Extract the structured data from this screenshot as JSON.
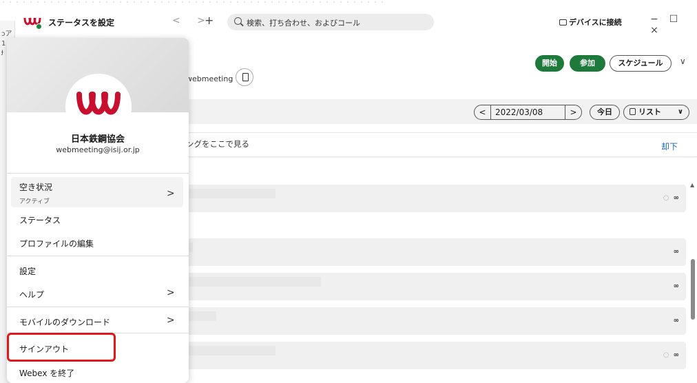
{
  "titlebar": {
    "title": "ステータスを設定",
    "nav_arrows": "< >",
    "add": "+",
    "search_placeholder": "検索、打ち合わせ、およびコール",
    "device_connect": "デバイスに接続",
    "win_min": "−",
    "win_max": "☐",
    "win_close": "×"
  },
  "header": {
    "meeting_id_suffix": "webmeeting",
    "start": "開始",
    "join": "参加",
    "schedule": "スケジュール",
    "chevron": "∨"
  },
  "datebar": {
    "prev": "<",
    "date": "2022/03/08",
    "next": ">",
    "today": "今日",
    "view": "リスト",
    "view_chevron": "∨"
  },
  "notice": {
    "text": "ングをここで見る",
    "dismiss": "却下"
  },
  "meeting_rows": [
    {
      "icons": "◌ ᴡ",
      "has_sync": true
    },
    {
      "icons": "ᴡ",
      "has_sync": false
    },
    {
      "icons": "ᴡ",
      "has_sync": false
    },
    {
      "icons": "ᴡ",
      "has_sync": false
    },
    {
      "icons": "◌ ᴡ",
      "has_sync": true
    }
  ],
  "row_icons": {
    "sync": "◌",
    "webex": "∞"
  },
  "profile": {
    "name": "日本鉄鋼協会",
    "email": "webmeeting@isij.or.jp"
  },
  "menu": {
    "availability": "空き状況",
    "availability_sub": "アクティブ",
    "chevron": ">",
    "status": "ステータス",
    "edit_profile": "プロファイルの編集",
    "settings": "設定",
    "help": "ヘルプ",
    "mobile_download": "モバイルのダウンロード",
    "sign_out": "サインアウト",
    "quit": "Webex を終了"
  },
  "colors": {
    "brand_green": "#1d7a3a",
    "logo_red": "#c8102e",
    "highlight_red": "#e01818",
    "link_blue": "#1565c0",
    "status_green": "#1a8a3e"
  },
  "bg_left": [
    "ɔア",
    "1",
    "ɟ"
  ]
}
